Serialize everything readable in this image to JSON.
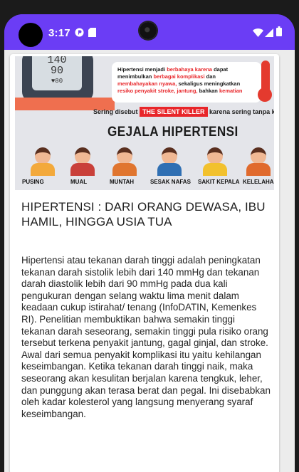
{
  "status_bar": {
    "time": "3:17"
  },
  "hero_image": {
    "gauge_top": "140",
    "gauge_mid": "90",
    "gauge_low": "♥80",
    "notice": {
      "part1": "Hipertensi menjadi ",
      "part2": "berbahaya karena",
      "part3": " dapat menimbulkan ",
      "part4": "berbagai komplikasi",
      "part5": " dan ",
      "part6": "membahayakan nyawa,",
      "part7": " sekaligus meningkatkan ",
      "part8": "resiko penyakit stroke, jantung,",
      "part9": " bahkan ",
      "part10": "kematian"
    },
    "silent_prefix": "Sering disebut",
    "silent_tag": "THE SILENT KILLER",
    "silent_suffix": "karena sering tanpa keluhan",
    "heading": "GEJALA HIPERTENSI",
    "symptoms": [
      "PUSING",
      "MUAL",
      "MUNTAH",
      "SESAK NAFAS",
      "SAKIT KEPALA",
      "KELELAHAN"
    ]
  },
  "article": {
    "title": "HIPERTENSI : DARI ORANG DEWASA, IBU HAMIL, HINGGA USIA TUA",
    "body": "Hipertensi atau tekanan darah tinggi adalah peningkatan tekanan darah sistolik lebih dari 140 mmHg dan tekanan darah diastolik lebih dari 90 mmHg pada dua kali pengukuran dengan selang waktu lima menit dalam keadaan cukup istirahat/ tenang (InfoDATIN, Kemenkes RI). Penelitian membuktikan bahwa semakin tinggi tekanan darah seseorang, semakin tinggi pula risiko orang tersebut terkena penyakit jantung, gagal ginjal, dan stroke. Awal dari semua penyakit komplikasi itu yaitu kehilangan keseimbangan. Ketika tekanan darah tinggi naik, maka seseorang akan kesulitan berjalan karena tengkuk, leher, dan punggung akan terasa berat dan pegal. Ini disebabkan oleh kadar kolesterol yang langsung menyerang syaraf keseimbangan."
  }
}
